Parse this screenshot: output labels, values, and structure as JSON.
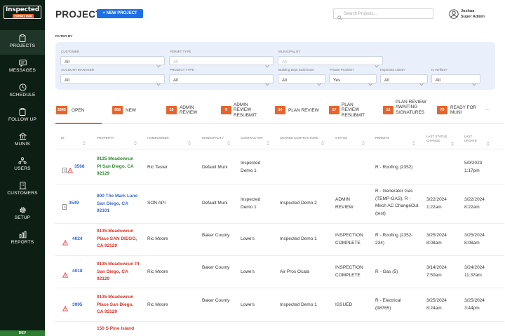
{
  "logo": {
    "main": "Inspected",
    "sub": "PERMIT HUB"
  },
  "nav": [
    {
      "label": "PROJECTS",
      "icon": "clipboard-icon"
    },
    {
      "label": "MESSAGES",
      "icon": "message-icon"
    },
    {
      "label": "SCHEDULE",
      "icon": "clock-icon"
    },
    {
      "label": "FOLLOW UP",
      "icon": "clipboard-check-icon"
    },
    {
      "label": "MUNIS",
      "icon": "building-icon"
    },
    {
      "label": "USERS",
      "icon": "users-icon"
    },
    {
      "label": "CUSTOMERS",
      "icon": "office-icon"
    },
    {
      "label": "SETUP",
      "icon": "gear-icon"
    },
    {
      "label": "REPORTS",
      "icon": "bar-chart-icon"
    }
  ],
  "env": "DEV",
  "header": {
    "title": "PROJECTS",
    "new_button": "+ NEW PROJECT",
    "search_placeholder": "Search Projects..."
  },
  "user": {
    "name": "Joshua",
    "role": "Super Admin"
  },
  "filters": {
    "heading": "FILTER BY",
    "customer": {
      "label": "CUSTOMER",
      "value": "All"
    },
    "permit_type": {
      "label": "PERMIT TYPE",
      "value": "All"
    },
    "municipality": {
      "label": "MUNICIPALITY",
      "value": "All"
    },
    "account_manager": {
      "label": "ACCOUNT MANAGER",
      "value": "All"
    },
    "project_type": {
      "label": "PROJECT TYPE",
      "value": "All"
    },
    "building_dept_switchover": {
      "label": "Building Dept Switchover",
      "value": "All"
    },
    "private_provider": {
      "label": "Private Provider?",
      "value": "Yes"
    },
    "inspected_listed": {
      "label": "Inspected Listed?",
      "value": "All"
    },
    "is_verified": {
      "label": "Is Verified?",
      "value": "All"
    }
  },
  "status_tabs": [
    {
      "count": "2645",
      "label": "OPEN"
    },
    {
      "count": "568",
      "label": "NEW"
    },
    {
      "count": "16",
      "label": "ADMIN REVIEW"
    },
    {
      "count": "8",
      "label": "ADMIN REVIEW RESUBMIT"
    },
    {
      "count": "14",
      "label": "PLAN REVIEW"
    },
    {
      "count": "17",
      "label": "PLAN REVIEW RESUBMIT"
    },
    {
      "count": "12",
      "label": "PLAN REVIEW AWAITING SIGNATURES"
    },
    {
      "count": "79",
      "label": "READY FOR MUNI"
    }
  ],
  "more_label": "...",
  "columns": [
    "ID",
    "PROPERTY",
    "HOMEOWNER",
    "MUNICIPALITY",
    "CONTRACTOR",
    "SHARED CONTRACTORS",
    "STATUS",
    "PERMITS",
    "LAST STATUS CHANGE",
    "LAST UPDATE"
  ],
  "rows": [
    {
      "id": "3568",
      "property": "9135 Meadowrun Pl San Diego, CA 92129",
      "homeowner": "Ric Tester",
      "municipality": "Default Muni",
      "contractor": "Inspected Demo 1",
      "shared": "",
      "status": "",
      "permits": "R - Roofing (2352)",
      "last_status_change": "",
      "last_update": "5/9/2023 1:17pm",
      "property_color": "#2e8b2e"
    },
    {
      "id": "3549",
      "property": "800 The Mark Lane San Diego, CA 92101",
      "homeowner": "SON API",
      "municipality": "Default Muni",
      "contractor": "Inspected Demo 1",
      "shared": "Inspected Demo 2",
      "status": "ADMIN REVIEW",
      "permits": "R - Generator Gas (TEMP-GAS), R - Mech AC ChangeOut (test)",
      "last_status_change": "3/22/2024 1:22am",
      "last_update": "3/22/2024 8:22am",
      "property_color": "#3d68c9"
    },
    {
      "id": "4024",
      "property": "9135 Meadowrun Place SAN DIEGO, CA 92129",
      "homeowner": "Ric Moore",
      "municipality": "Baker County",
      "contractor": "Lowe's",
      "shared": "Inspected Demo 1",
      "status": "INSPECTION COMPLETE",
      "permits": "R - Roofing (2352-234)",
      "last_status_change": "3/25/2024 8:08am",
      "last_update": "3/25/2024 8:08am",
      "property_color": "#d93025"
    },
    {
      "id": "4018",
      "property": "9135 Meadowrun Pl San Diego, CA 92129",
      "homeowner": "Ric Moore",
      "municipality": "Baker County",
      "contractor": "Lowe's",
      "shared": "Air Pros Ocala",
      "status": "INSPECTION COMPLETE",
      "permits": "R - Gas (5)",
      "last_status_change": "3/14/2024 7:50am",
      "last_update": "3/24/2024 11:37am",
      "property_color": "#d93025"
    },
    {
      "id": "3995",
      "property": "9135 Meadowrun Place San Diego, CA 92129",
      "homeowner": "Ric Moore",
      "municipality": "Baker County",
      "contractor": "Lowe's",
      "shared": "Inspected Demo 1",
      "status": "ISSUED",
      "permits": "R - Electrical (98765)",
      "last_status_change": "3/25/2024 8:24am",
      "last_update": "3/25/2024 3:44pm",
      "property_color": "#d93025"
    },
    {
      "id": "",
      "property": "150 S Pine Island",
      "homeowner": "",
      "municipality": "",
      "contractor": "",
      "shared": "",
      "status": "",
      "permits": "",
      "last_status_change": "",
      "last_update": "",
      "property_color": "#d93025"
    }
  ],
  "colors": {
    "sidebar": "#0d1f14",
    "accent": "#e8642c",
    "link": "#2d67d3",
    "primary_button": "#1d6fe6",
    "warning": "#e53935",
    "filter_bg": "#eaf0fb"
  }
}
